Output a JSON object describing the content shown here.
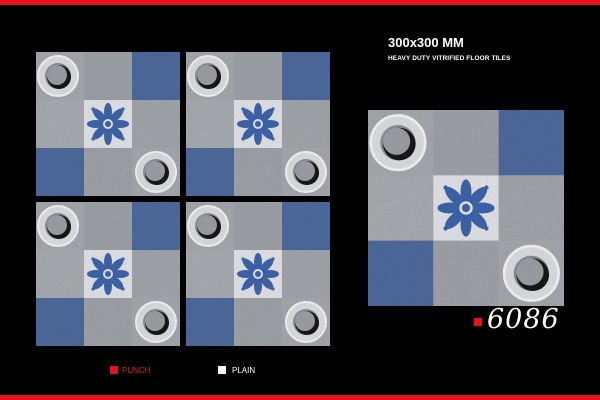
{
  "heading": {
    "size": "300x300 MM",
    "description": "HEAVY DUTY VITRIFIED FLOOR TILES"
  },
  "product_code": "6086",
  "legend": {
    "punch_label": "PUNCH",
    "plain_label": "PLAIN"
  },
  "colors": {
    "accent_red": "#e8141c",
    "tile_blue": "#4d6a9c",
    "tile_grey": "#a5a8ad",
    "tile_light": "#e2e3e7",
    "flower_blue": "#3d64aa",
    "legend_red_text": "#e02020",
    "legend_white_text": "#ffffff"
  },
  "tiles": {
    "preview_count": 4,
    "layout": "2x2 grid of preview tiles plus one enlarged tile"
  }
}
